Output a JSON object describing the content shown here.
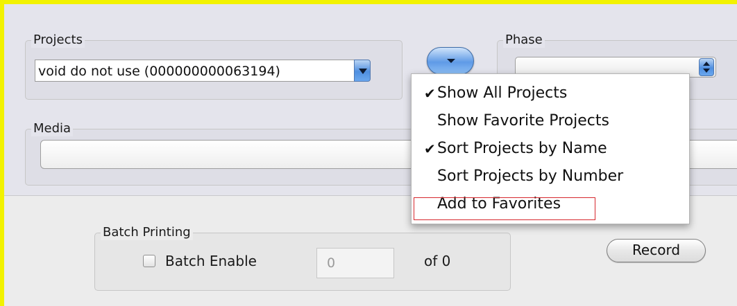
{
  "projects": {
    "label": "Projects",
    "selected": "void do not use (000000000063194)"
  },
  "phase": {
    "label": "Phase",
    "selected": ""
  },
  "media": {
    "label": "Media",
    "value": ""
  },
  "menu": {
    "items": [
      {
        "label": "Show All Projects",
        "checked": true,
        "check": "✔"
      },
      {
        "label": "Show Favorite Projects",
        "checked": false,
        "check": ""
      },
      {
        "label": "Sort Projects by Name",
        "checked": true,
        "check": "✔"
      },
      {
        "label": "Sort Projects by Number",
        "checked": false,
        "check": ""
      },
      {
        "label": "Add to Favorites",
        "checked": false,
        "check": "",
        "highlighted": true
      }
    ]
  },
  "batch": {
    "label": "Batch Printing",
    "enable_label": "Batch Enable",
    "enabled": false,
    "count_value": "0",
    "of_label": "of 0"
  },
  "record_button": "Record",
  "colors": {
    "window_border": "#f2f200",
    "menu_highlight_border": "#d6262c",
    "aqua_blue": "#5f9ae6"
  },
  "icons": {
    "popup_button": "chevron-down-icon",
    "combo_arrow": "chevron-down-icon",
    "phase_stepper": "up-down-arrows-icon",
    "check": "checkmark-icon"
  }
}
